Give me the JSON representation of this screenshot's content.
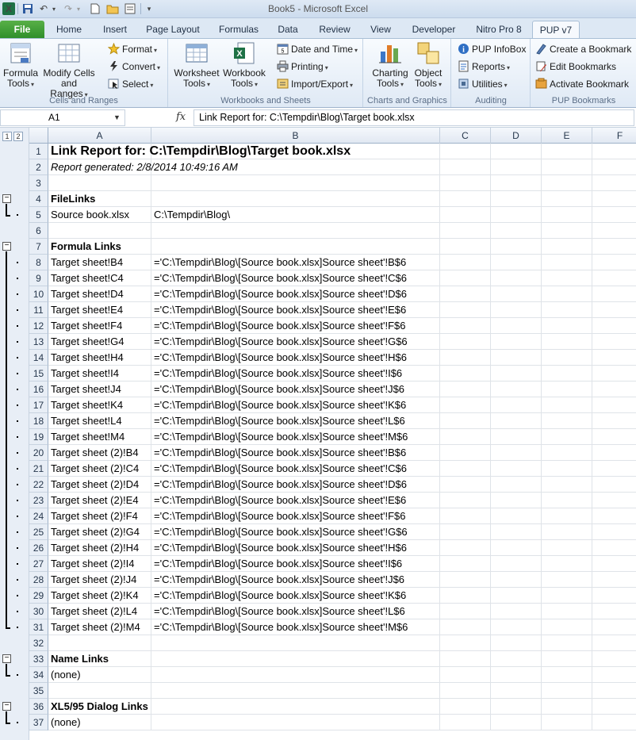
{
  "window": {
    "title": "Book5 - Microsoft Excel"
  },
  "tabs": [
    "File",
    "Home",
    "Insert",
    "Page Layout",
    "Formulas",
    "Data",
    "Review",
    "View",
    "Developer",
    "Nitro Pro 8",
    "PUP v7"
  ],
  "ribbon": {
    "groups": {
      "cells_ranges": "Cells and Ranges",
      "workbooks_sheets": "Workbooks and Sheets",
      "charts_graphics": "Charts and Graphics",
      "auditing": "Auditing",
      "pup_bookmarks": "PUP Bookmarks"
    },
    "formula_tools": [
      "Formula",
      "Tools"
    ],
    "modify_cells": [
      "Modify Cells",
      "and Ranges"
    ],
    "format": "Format",
    "convert": "Convert",
    "select": "Select",
    "worksheet_tools": [
      "Worksheet",
      "Tools"
    ],
    "workbook_tools": [
      "Workbook",
      "Tools"
    ],
    "date_time": "Date and Time",
    "printing": "Printing",
    "import_export": "Import/Export",
    "charting_tools": [
      "Charting",
      "Tools"
    ],
    "object_tools": [
      "Object",
      "Tools"
    ],
    "pup_infobox": "PUP InfoBox",
    "reports": "Reports",
    "utilities": "Utilities",
    "create_bookmark": "Create a Bookmark",
    "edit_bookmarks": "Edit Bookmarks",
    "activate_bookmark": "Activate Bookmark"
  },
  "formula_bar": {
    "name_box": "A1",
    "fx": "fx",
    "content": "Link Report for: C:\\Tempdir\\Blog\\Target book.xlsx"
  },
  "outline_levels": [
    "1",
    "2"
  ],
  "columns": [
    "A",
    "B",
    "C",
    "D",
    "E",
    "F"
  ],
  "rows": [
    {
      "n": "1",
      "a": "Link Report for: C:\\Tempdir\\Blog\\Target book.xlsx",
      "b": ""
    },
    {
      "n": "2",
      "a": "Report generated: 2/8/2014 10:49:16 AM",
      "b": ""
    },
    {
      "n": "3",
      "a": "",
      "b": ""
    },
    {
      "n": "4",
      "a": "FileLinks",
      "b": ""
    },
    {
      "n": "5",
      "a": "Source book.xlsx",
      "b": "C:\\Tempdir\\Blog\\"
    },
    {
      "n": "6",
      "a": "",
      "b": ""
    },
    {
      "n": "7",
      "a": "Formula Links",
      "b": ""
    },
    {
      "n": "8",
      "a": "Target sheet!B4",
      "b": "='C:\\Tempdir\\Blog\\[Source book.xlsx]Source sheet'!B$6"
    },
    {
      "n": "9",
      "a": "Target sheet!C4",
      "b": "='C:\\Tempdir\\Blog\\[Source book.xlsx]Source sheet'!C$6"
    },
    {
      "n": "10",
      "a": "Target sheet!D4",
      "b": "='C:\\Tempdir\\Blog\\[Source book.xlsx]Source sheet'!D$6"
    },
    {
      "n": "11",
      "a": "Target sheet!E4",
      "b": "='C:\\Tempdir\\Blog\\[Source book.xlsx]Source sheet'!E$6"
    },
    {
      "n": "12",
      "a": "Target sheet!F4",
      "b": "='C:\\Tempdir\\Blog\\[Source book.xlsx]Source sheet'!F$6"
    },
    {
      "n": "13",
      "a": "Target sheet!G4",
      "b": "='C:\\Tempdir\\Blog\\[Source book.xlsx]Source sheet'!G$6"
    },
    {
      "n": "14",
      "a": "Target sheet!H4",
      "b": "='C:\\Tempdir\\Blog\\[Source book.xlsx]Source sheet'!H$6"
    },
    {
      "n": "15",
      "a": "Target sheet!I4",
      "b": "='C:\\Tempdir\\Blog\\[Source book.xlsx]Source sheet'!I$6"
    },
    {
      "n": "16",
      "a": "Target sheet!J4",
      "b": "='C:\\Tempdir\\Blog\\[Source book.xlsx]Source sheet'!J$6"
    },
    {
      "n": "17",
      "a": "Target sheet!K4",
      "b": "='C:\\Tempdir\\Blog\\[Source book.xlsx]Source sheet'!K$6"
    },
    {
      "n": "18",
      "a": "Target sheet!L4",
      "b": "='C:\\Tempdir\\Blog\\[Source book.xlsx]Source sheet'!L$6"
    },
    {
      "n": "19",
      "a": "Target sheet!M4",
      "b": "='C:\\Tempdir\\Blog\\[Source book.xlsx]Source sheet'!M$6"
    },
    {
      "n": "20",
      "a": "Target sheet (2)!B4",
      "b": "='C:\\Tempdir\\Blog\\[Source book.xlsx]Source sheet'!B$6"
    },
    {
      "n": "21",
      "a": "Target sheet (2)!C4",
      "b": "='C:\\Tempdir\\Blog\\[Source book.xlsx]Source sheet'!C$6"
    },
    {
      "n": "22",
      "a": "Target sheet (2)!D4",
      "b": "='C:\\Tempdir\\Blog\\[Source book.xlsx]Source sheet'!D$6"
    },
    {
      "n": "23",
      "a": "Target sheet (2)!E4",
      "b": "='C:\\Tempdir\\Blog\\[Source book.xlsx]Source sheet'!E$6"
    },
    {
      "n": "24",
      "a": "Target sheet (2)!F4",
      "b": "='C:\\Tempdir\\Blog\\[Source book.xlsx]Source sheet'!F$6"
    },
    {
      "n": "25",
      "a": "Target sheet (2)!G4",
      "b": "='C:\\Tempdir\\Blog\\[Source book.xlsx]Source sheet'!G$6"
    },
    {
      "n": "26",
      "a": "Target sheet (2)!H4",
      "b": "='C:\\Tempdir\\Blog\\[Source book.xlsx]Source sheet'!H$6"
    },
    {
      "n": "27",
      "a": "Target sheet (2)!I4",
      "b": "='C:\\Tempdir\\Blog\\[Source book.xlsx]Source sheet'!I$6"
    },
    {
      "n": "28",
      "a": "Target sheet (2)!J4",
      "b": "='C:\\Tempdir\\Blog\\[Source book.xlsx]Source sheet'!J$6"
    },
    {
      "n": "29",
      "a": "Target sheet (2)!K4",
      "b": "='C:\\Tempdir\\Blog\\[Source book.xlsx]Source sheet'!K$6"
    },
    {
      "n": "30",
      "a": "Target sheet (2)!L4",
      "b": "='C:\\Tempdir\\Blog\\[Source book.xlsx]Source sheet'!L$6"
    },
    {
      "n": "31",
      "a": "Target sheet (2)!M4",
      "b": "='C:\\Tempdir\\Blog\\[Source book.xlsx]Source sheet'!M$6"
    },
    {
      "n": "32",
      "a": "",
      "b": ""
    },
    {
      "n": "33",
      "a": "Name Links",
      "b": ""
    },
    {
      "n": "34",
      "a": "(none)",
      "b": ""
    },
    {
      "n": "35",
      "a": "",
      "b": ""
    },
    {
      "n": "36",
      "a": "XL5/95 Dialog Links",
      "b": ""
    },
    {
      "n": "37",
      "a": "(none)",
      "b": ""
    }
  ]
}
